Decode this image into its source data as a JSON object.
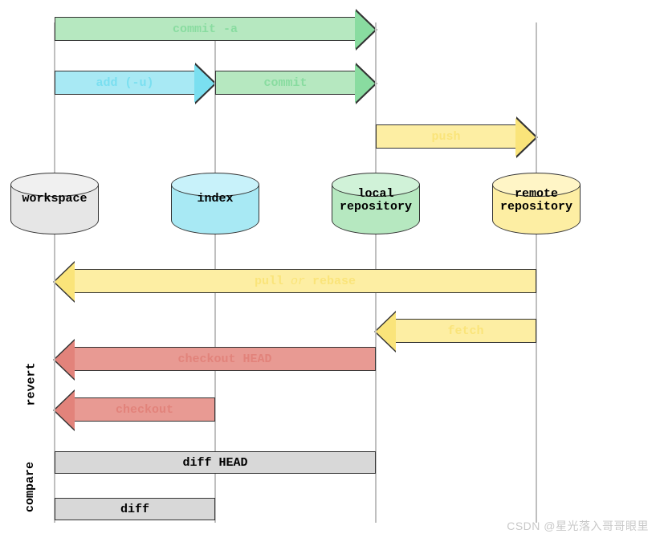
{
  "colors": {
    "green_fill": "#b6e8c0",
    "green_head": "#89dca0",
    "cyan_fill": "#a8e9f4",
    "cyan_head": "#7adff0",
    "yellow_fill": "#fdeea3",
    "yellow_head": "#fae47a",
    "red_fill": "#e89a93",
    "red_head": "#e2837b",
    "gray_fill": "#d8d8d8",
    "gray_head": "#d8d8d8",
    "cyl_gray": "#e6e6e6",
    "cyl_cyan": "#a8e9f4",
    "cyl_green": "#b6e8c0",
    "cyl_yellow": "#fdeea3"
  },
  "stages": {
    "workspace": "workspace",
    "index": "index",
    "local": "local repository",
    "remote": "remote repository"
  },
  "commands": {
    "commit_a": "commit -a",
    "add_u": "add (-u)",
    "commit": "commit",
    "push": "push",
    "pull_rebase_a": "pull ",
    "pull_rebase_b": "or",
    "pull_rebase_c": " rebase",
    "fetch": "fetch",
    "checkout_head": "checkout HEAD",
    "checkout": "checkout",
    "diff_head": "diff HEAD",
    "diff": "diff"
  },
  "sections": {
    "revert": "revert",
    "compare": "compare"
  },
  "watermark": "CSDN @星光落入哥哥眼里",
  "chart_data": {
    "type": "diagram",
    "title": "Git data flow between storage areas",
    "nodes": [
      {
        "id": "workspace",
        "label": "workspace"
      },
      {
        "id": "index",
        "label": "index"
      },
      {
        "id": "local",
        "label": "local repository"
      },
      {
        "id": "remote",
        "label": "remote repository"
      }
    ],
    "edges": [
      {
        "from": "workspace",
        "to": "local",
        "label": "commit -a",
        "group": "forward"
      },
      {
        "from": "workspace",
        "to": "index",
        "label": "add (-u)",
        "group": "forward"
      },
      {
        "from": "index",
        "to": "local",
        "label": "commit",
        "group": "forward"
      },
      {
        "from": "local",
        "to": "remote",
        "label": "push",
        "group": "forward"
      },
      {
        "from": "remote",
        "to": "workspace",
        "label": "pull or rebase",
        "group": "reverse"
      },
      {
        "from": "remote",
        "to": "local",
        "label": "fetch",
        "group": "reverse"
      },
      {
        "from": "local",
        "to": "workspace",
        "label": "checkout HEAD",
        "group": "revert"
      },
      {
        "from": "index",
        "to": "workspace",
        "label": "checkout",
        "group": "revert"
      },
      {
        "from": "workspace",
        "to": "local",
        "label": "diff HEAD",
        "group": "compare",
        "bidirectional": true
      },
      {
        "from": "workspace",
        "to": "index",
        "label": "diff",
        "group": "compare",
        "bidirectional": true
      }
    ]
  }
}
